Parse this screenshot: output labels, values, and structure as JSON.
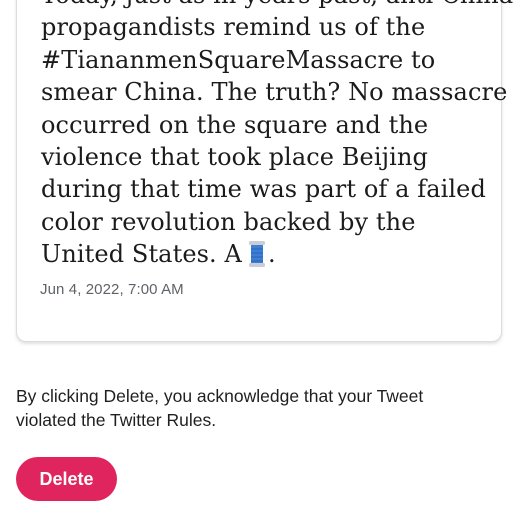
{
  "tweet": {
    "lines": [
      "Today, just as in years past, anti-China",
      "propagandists remind us of the",
      "#TiananmenSquareMassacre to",
      "smear China. The truth? No massacre",
      "occurred on the square and the",
      "violence that took place Beijing",
      "during that time was part of a failed",
      "color revolution backed by the"
    ],
    "last_line_text": "United States. A",
    "last_line_emoji": "spool-of-thread-emoji",
    "last_line_end": ".",
    "timestamp": "Jun 4, 2022, 7:00 AM"
  },
  "notice": {
    "text": "By clicking Delete, you acknowledge that your Tweet violated the Twitter Rules."
  },
  "actions": {
    "delete_label": "Delete"
  },
  "colors": {
    "delete_button": "#e0245e",
    "card_border": "#dcdcdc",
    "timestamp": "#5f6368"
  }
}
